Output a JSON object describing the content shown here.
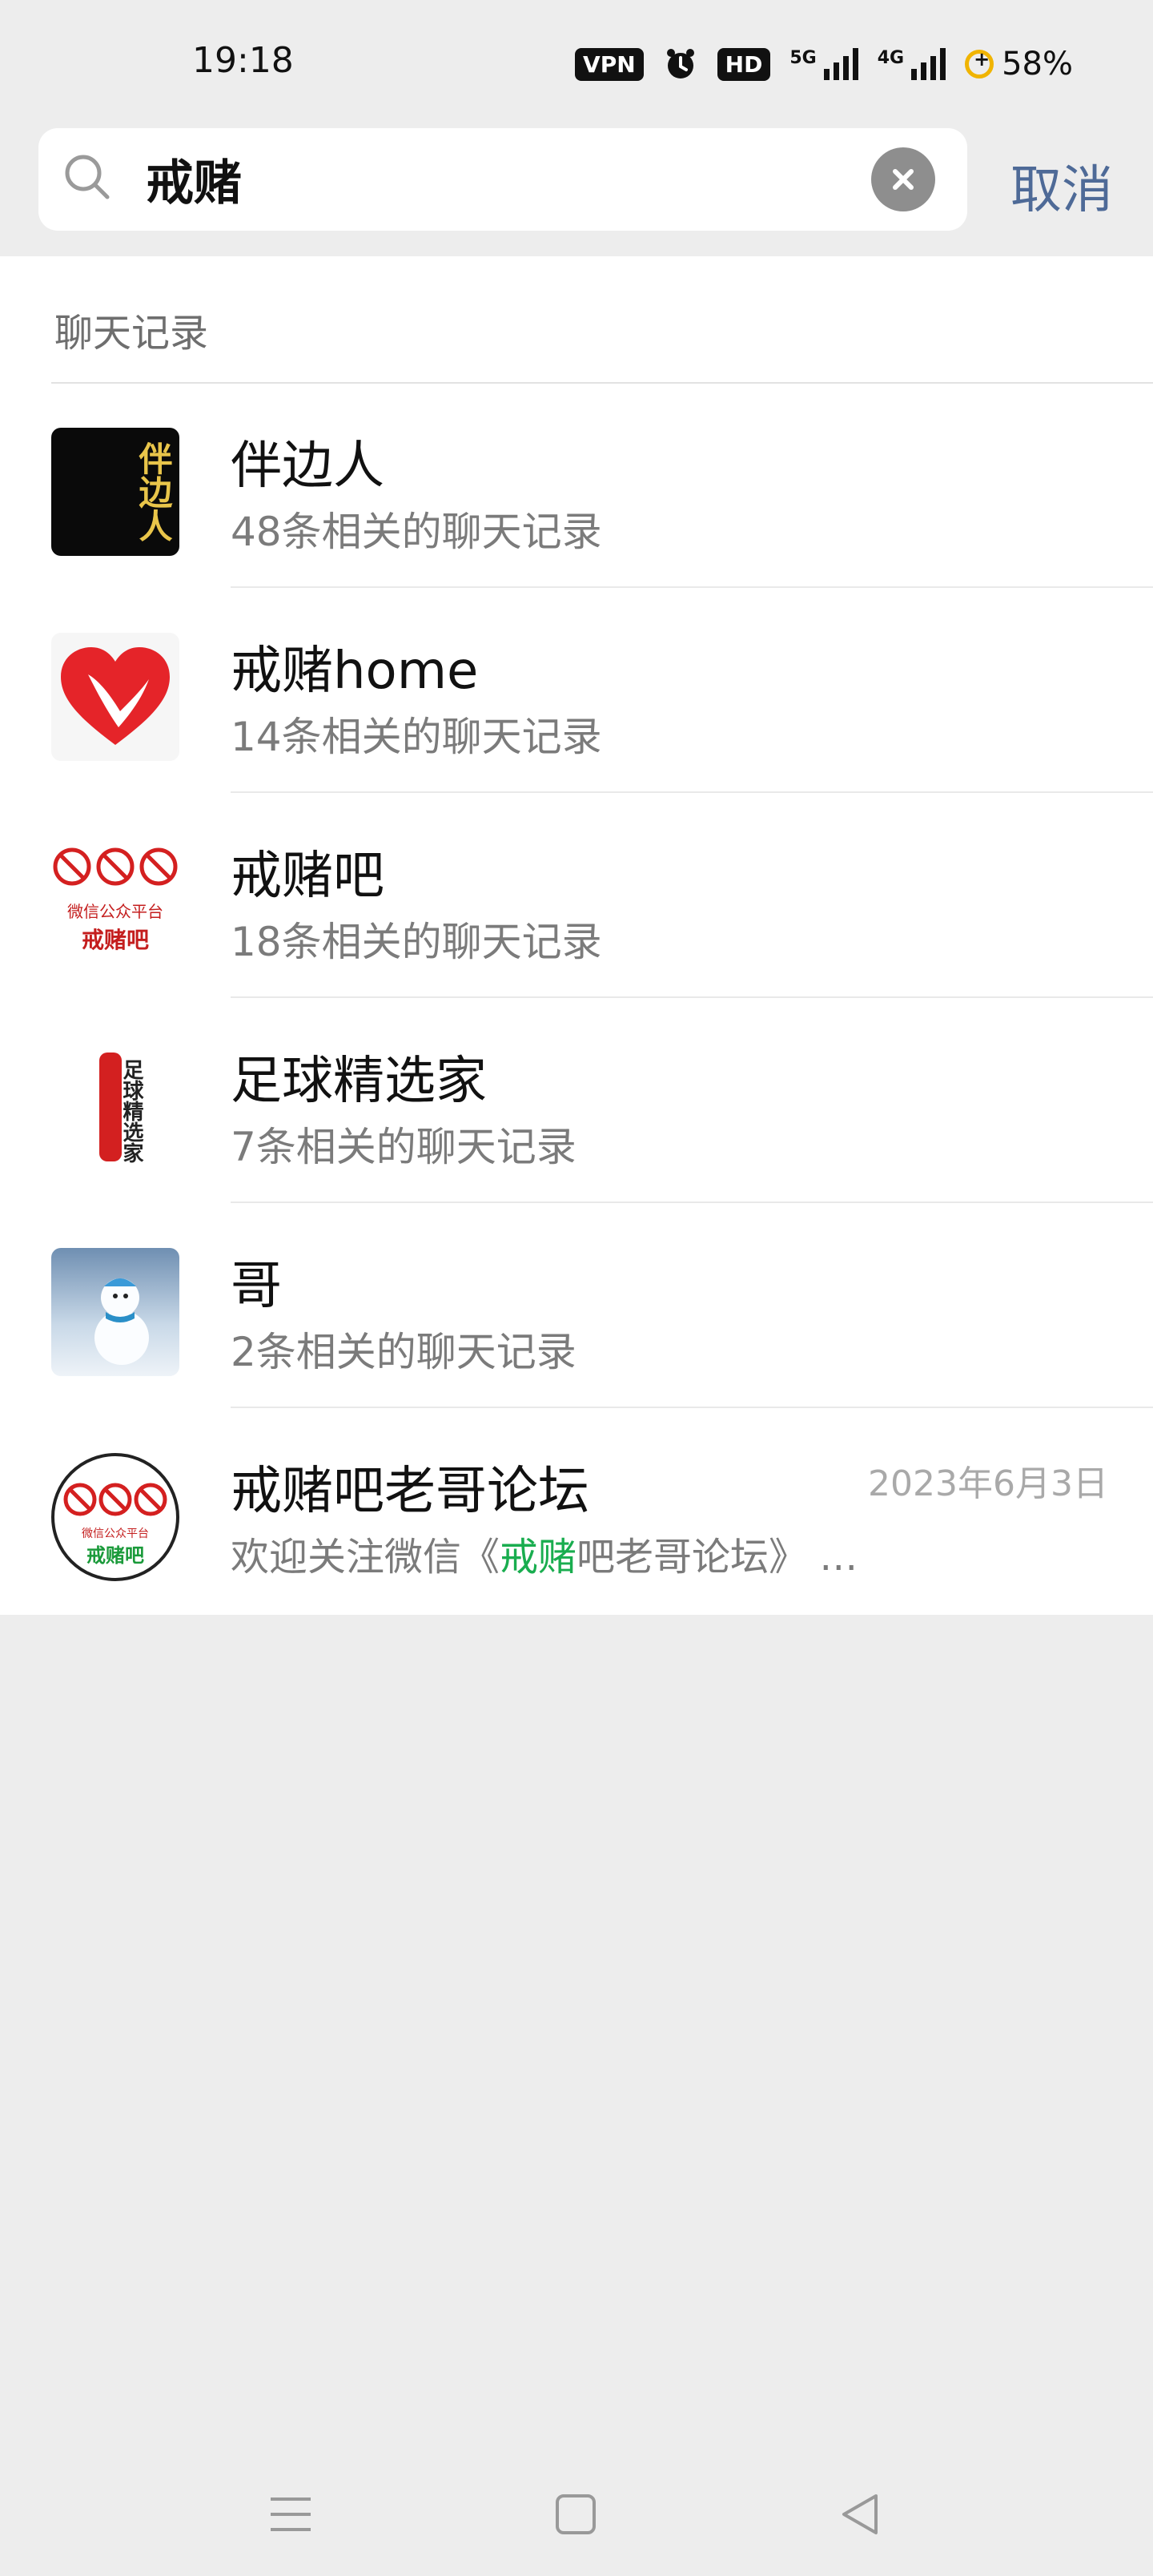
{
  "status_bar": {
    "time": "19:18",
    "vpn": "VPN",
    "hd": "HD",
    "net1": "5G",
    "net2": "4G",
    "battery": "58%"
  },
  "search": {
    "query": "戒赌",
    "cancel_label": "取消"
  },
  "results": {
    "section_title": "聊天记录",
    "items": [
      {
        "name": "伴边人",
        "subtitle": "48条相关的聊天记录"
      },
      {
        "name": "戒赌home",
        "subtitle": "14条相关的聊天记录"
      },
      {
        "name": "戒赌吧",
        "subtitle": "18条相关的聊天记录"
      },
      {
        "name": "足球精选家",
        "subtitle": "7条相关的聊天记录"
      },
      {
        "name": "哥",
        "subtitle": "2条相关的聊天记录"
      },
      {
        "name": "戒赌吧老哥论坛",
        "date": "2023年6月3日",
        "subtitle_prefix": "欢迎关注微信《",
        "subtitle_highlight": "戒赌",
        "subtitle_suffix": "吧老哥论坛》 …"
      }
    ]
  },
  "avatar_text": {
    "item0": "伴边人",
    "item2_top": "微信公众平台",
    "item2_bottom": "戒赌吧",
    "item3": "足球精选家",
    "item5_top": "微信公众平台",
    "item5_bottom": "戒赌吧"
  },
  "icons": {
    "search": "search-icon",
    "clear": "clear-icon",
    "nav_menu": "menu-icon",
    "nav_home": "home-icon",
    "nav_back": "back-icon"
  },
  "colors": {
    "link": "#4e6a97",
    "highlight": "#19ad4f",
    "background": "#ededed"
  }
}
